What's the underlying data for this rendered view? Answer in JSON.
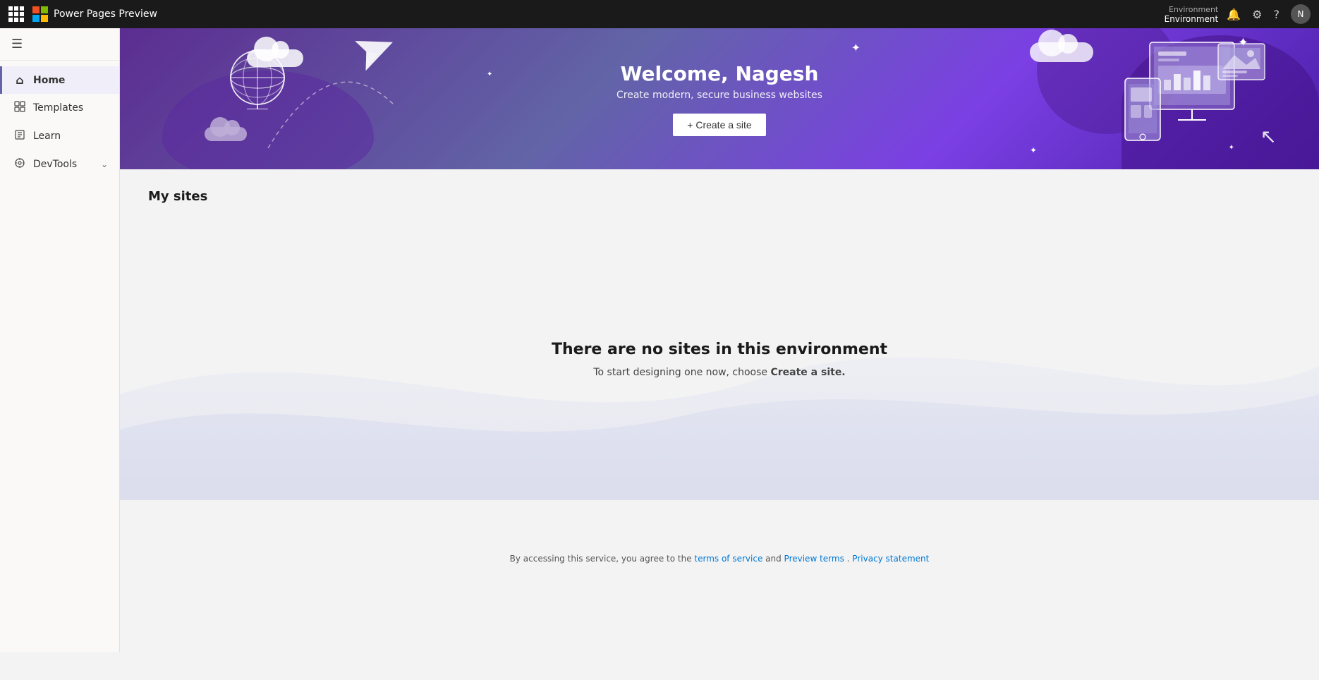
{
  "topbar": {
    "app_title": "Power Pages Preview",
    "environment_label": "Environment",
    "environment_name": "Environment",
    "icons": {
      "notification": "🔔",
      "settings": "⚙",
      "help": "?",
      "avatar_initials": "N"
    }
  },
  "sidebar": {
    "hamburger_label": "☰",
    "items": [
      {
        "id": "home",
        "label": "Home",
        "icon": "⌂",
        "active": true
      },
      {
        "id": "templates",
        "label": "Templates",
        "icon": "⊞",
        "active": false
      },
      {
        "id": "learn",
        "label": "Learn",
        "icon": "📖",
        "active": false
      },
      {
        "id": "devtools",
        "label": "DevTools",
        "icon": "🛠",
        "active": false,
        "has_chevron": true
      }
    ]
  },
  "hero": {
    "title": "Welcome, Nagesh",
    "subtitle": "Create modern, secure business websites",
    "cta_label": "+ Create a site"
  },
  "my_sites": {
    "section_title": "My sites"
  },
  "empty_state": {
    "title": "There are no sites in this environment",
    "description": "To start designing one now, choose ",
    "cta_text": "Create a site."
  },
  "footer": {
    "prefix": "By accessing this service, you agree to the ",
    "terms_label": "terms of service",
    "separator1": " and ",
    "preview_label": "Preview terms",
    "separator2": ". ",
    "privacy_label": "Privacy statement"
  }
}
